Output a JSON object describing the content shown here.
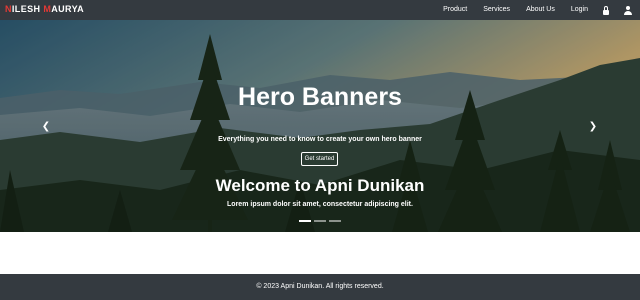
{
  "brand": {
    "prefix": "N",
    "name1_rest": "ILESH ",
    "m": "M",
    "name2_rest": "AURYA"
  },
  "nav": {
    "items": [
      {
        "label": "Product"
      },
      {
        "label": "Services"
      },
      {
        "label": "About Us"
      },
      {
        "label": "Login"
      }
    ],
    "icons": [
      "lock-icon",
      "user-icon"
    ]
  },
  "hero": {
    "title": "Hero Banners",
    "subtitle": "Everything you need to know to create your own hero banner",
    "button_label": "Get started",
    "welcome": "Welcome to Apni Dunikan",
    "lorem": "Lorem ipsum dolor sit amet, consectetur adipiscing elit.",
    "prev_icon": "chevron-left-icon",
    "next_icon": "chevron-right-icon",
    "slide_count": 3,
    "active_slide": 1
  },
  "footer": {
    "text": "© 2023 Apni Dunikan. All rights reserved."
  },
  "colors": {
    "navbar": "#343a40",
    "brand_accent": "#e53935",
    "footer": "#343a40"
  }
}
